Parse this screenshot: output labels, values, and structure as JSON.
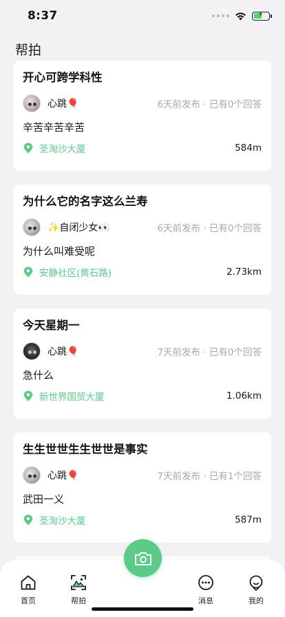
{
  "status_bar": {
    "time": "8:37"
  },
  "page": {
    "title": "帮拍"
  },
  "posts": [
    {
      "title": "开心可跨学科性",
      "username": "心跳🎈",
      "meta": "6天前发布 · 已有0个回答",
      "body": "辛苦辛苦辛苦",
      "location": "圣淘沙大厦",
      "distance": "584m",
      "avatar": "light"
    },
    {
      "title": "为什么它的名字这么兰寿",
      "username": "✨自闭少女👀",
      "meta": "6天前发布 · 已有0个回答",
      "body": "为什么叫难受呢",
      "location": "安静社区(黄石路)",
      "distance": "2.73km",
      "avatar": "light"
    },
    {
      "title": "今天星期一",
      "username": "心跳🎈",
      "meta": "7天前发布 · 已有0个回答",
      "body": "急什么",
      "location": "新世界国贸大厦",
      "distance": "1.06km",
      "avatar": "dark"
    },
    {
      "title": "生生世世生生世世是事实",
      "username": "心跳🎈",
      "meta": "7天前发布 · 已有1个回答",
      "body": "武田一义",
      "location": "圣淘沙大厦",
      "distance": "587m",
      "avatar": "light"
    }
  ],
  "tabs": [
    {
      "label": "首页",
      "icon": "home-icon"
    },
    {
      "label": "帮拍",
      "icon": "photo-help-icon"
    },
    {
      "label": "消息",
      "icon": "message-icon"
    },
    {
      "label": "我的",
      "icon": "profile-icon"
    }
  ],
  "colors": {
    "accent": "#5ccb8a",
    "background": "#f2f2f4",
    "muted_text": "#a8a8ac"
  }
}
